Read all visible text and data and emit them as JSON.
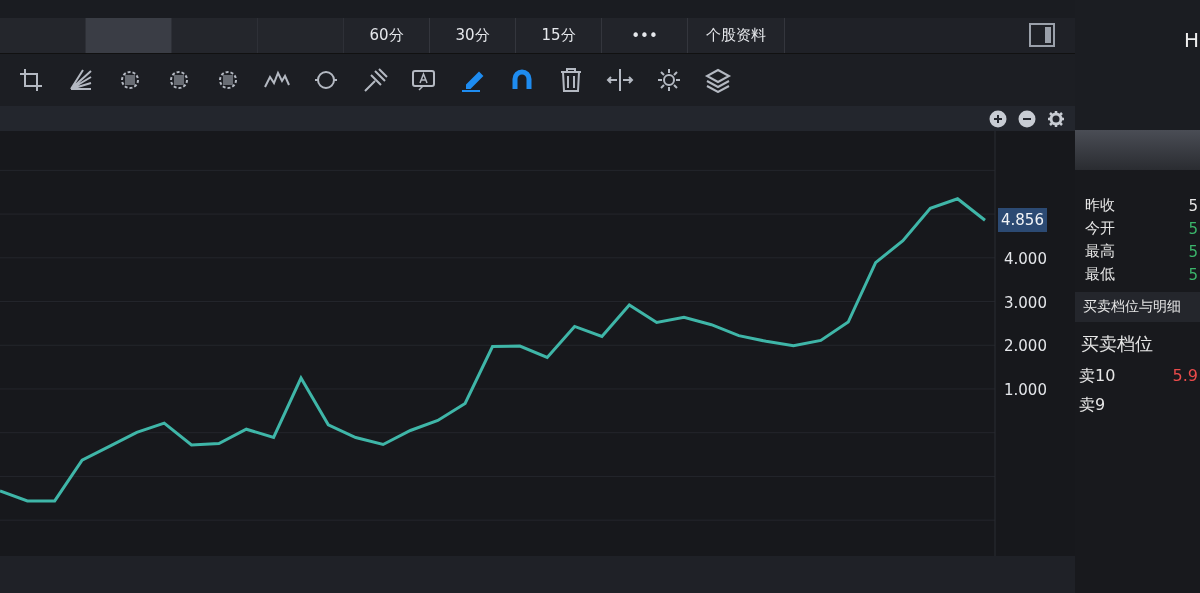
{
  "period_tabs": [
    {
      "label": "60分"
    },
    {
      "label": "30分"
    },
    {
      "label": "15分"
    },
    {
      "label": "•••"
    },
    {
      "label": "个股资料"
    }
  ],
  "header_letter": "H",
  "drawing_tools": [
    {
      "kind": "crop",
      "selected": false
    },
    {
      "kind": "fan",
      "selected": false
    },
    {
      "kind": "blur",
      "selected": false
    },
    {
      "kind": "blur",
      "selected": false
    },
    {
      "kind": "blur",
      "selected": false
    },
    {
      "kind": "wave",
      "selected": false
    },
    {
      "kind": "cycle",
      "selected": false
    },
    {
      "kind": "fork",
      "selected": false
    },
    {
      "kind": "note",
      "selected": false
    },
    {
      "kind": "pen",
      "selected": true
    },
    {
      "kind": "magnet",
      "selected": true
    },
    {
      "kind": "trash",
      "selected": false
    },
    {
      "kind": "split",
      "selected": false
    },
    {
      "kind": "gear",
      "selected": false
    },
    {
      "kind": "layers",
      "selected": false
    }
  ],
  "chart": {
    "current_price_label": "4.856",
    "chart_data": {
      "type": "line",
      "ylim": [
        -2.82,
        6.9
      ],
      "grid": true,
      "yticks": [
        {
          "value": 1,
          "label": "1.000"
        },
        {
          "value": 2,
          "label": "2.000"
        },
        {
          "value": 3,
          "label": "3.000"
        },
        {
          "value": 4,
          "label": "4.000"
        }
      ],
      "series": [
        {
          "color": "#3fb6a8",
          "values": [
            -1.33,
            -1.56,
            -1.56,
            -0.63,
            -0.31,
            0.01,
            0.22,
            -0.28,
            -0.25,
            0.08,
            -0.11,
            1.25,
            0.18,
            -0.11,
            -0.27,
            0.05,
            0.28,
            0.67,
            1.97,
            1.98,
            1.72,
            2.43,
            2.2,
            2.92,
            2.52,
            2.64,
            2.47,
            2.22,
            2.09,
            1.99,
            2.11,
            2.53,
            3.89,
            4.39,
            5.13,
            5.35,
            4.86
          ]
        }
      ]
    }
  },
  "quote_rows": [
    {
      "label": "昨收",
      "value": "5",
      "color": "#e6e6e6"
    },
    {
      "label": "今开",
      "value": "5",
      "color": "#3bb56b"
    },
    {
      "label": "最高",
      "value": "5",
      "color": "#3bb56b"
    },
    {
      "label": "最低",
      "value": "5",
      "color": "#3bb56b"
    }
  ],
  "section_title": "买卖档位与明细",
  "order_book_title": "买卖档位",
  "asks": [
    {
      "label": "卖10",
      "price": "5.9"
    },
    {
      "label": "卖9"
    }
  ]
}
